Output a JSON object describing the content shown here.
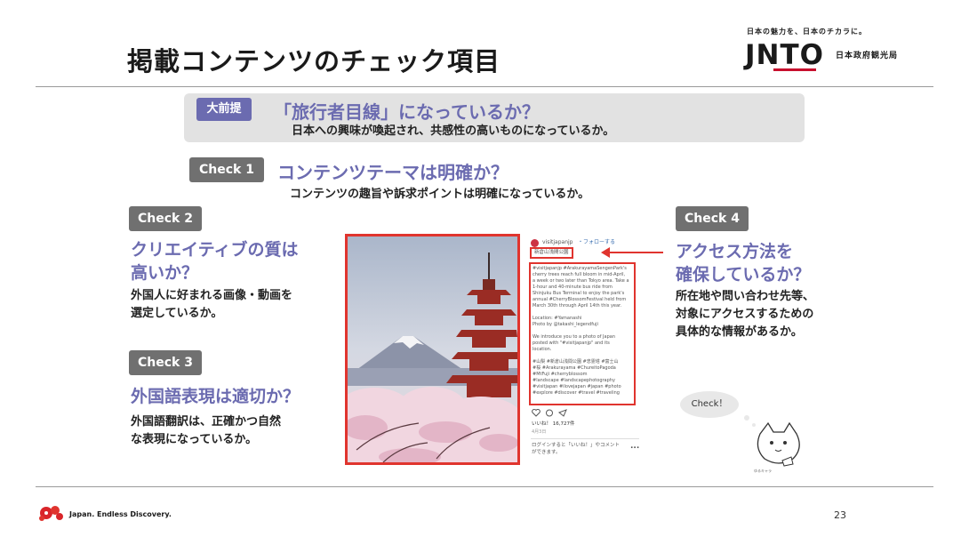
{
  "title": "掲載コンテンツのチェック項目",
  "header": {
    "tagline": "日本の魅力を、日本のチカラに。",
    "logo_text": "JNTO",
    "org_name": "日本政府観光局"
  },
  "premise": {
    "badge": "大前提",
    "heading": "「旅行者目線」になっているか？",
    "description": "日本への興味が喚起され、共感性の高いものになっているか。"
  },
  "checks": [
    {
      "label": "Check 1",
      "heading": "コンテンツテーマは明確か？",
      "description": "コンテンツの趣旨や訴求ポイントは明確になっているか。"
    },
    {
      "label": "Check 2",
      "heading_line1": "クリエイティブの質は",
      "heading_line2": "高いか？",
      "description_line1": "外国人に好まれる画像・動画を",
      "description_line2": "選定しているか。"
    },
    {
      "label": "Check 3",
      "heading": "外国語表現は適切か？",
      "description_line1": "外国語翻訳は、正確かつ自然",
      "description_line2": "な表現になっているか。"
    },
    {
      "label": "Check 4",
      "heading_line1": "アクセス方法を",
      "heading_line2": "確保しているか？",
      "description_line1": "所在地や問い合わせ先等、",
      "description_line2": "対象にアクセスするための",
      "description_line3": "具体的な情報があるか。"
    }
  ],
  "instagram": {
    "account": "visitjapanjp",
    "follow": "・フォローする",
    "location": "新倉山浅間公園",
    "caption": [
      "#visitjapanjp #ArakurayamaSengenPark's",
      "cherry trees reach full bloom in mid-April,",
      "a week or two later than Tokyo area. Take a",
      "1-hour and 40-minute bus ride from",
      "Shinjuku Bus Terminal to enjoy the park's",
      "annual #CherryBlossomFestival held from",
      "March 30th through April 14th this year.",
      "",
      "Location: #Yamanashi",
      "Photo by @takashi_legendfuji",
      "",
      "We introduce you to a photo of Japan",
      "posted with \"#visitjapanjp\" and its",
      "location.",
      "",
      "#山梨 #新倉山浅間公園 #忠霊塔 #富士山",
      "#桜 #Arakurayama #ChureitoPagoda",
      "#MtFuji #cherryblossom",
      "#landscape #landscapephotography",
      "#visitjapan #ilovejapan #japan #photo",
      "#explore #discover #travel #traveling"
    ],
    "likes": "いいね！ 16,727件",
    "date": "4月3日",
    "login_prompt_line1": "ログインすると「いいね！」やコメント",
    "login_prompt_line2": "ができます。",
    "more": "..."
  },
  "mascot": {
    "bubble": "Check！",
    "caption": "ゆるキャラ"
  },
  "footer": {
    "slogan": "Japan. Endless Discovery.",
    "page_number": "23"
  },
  "colors": {
    "accent_blue": "#6b6bb0",
    "badge_gray": "#707070",
    "highlight_red": "#e0342e"
  }
}
